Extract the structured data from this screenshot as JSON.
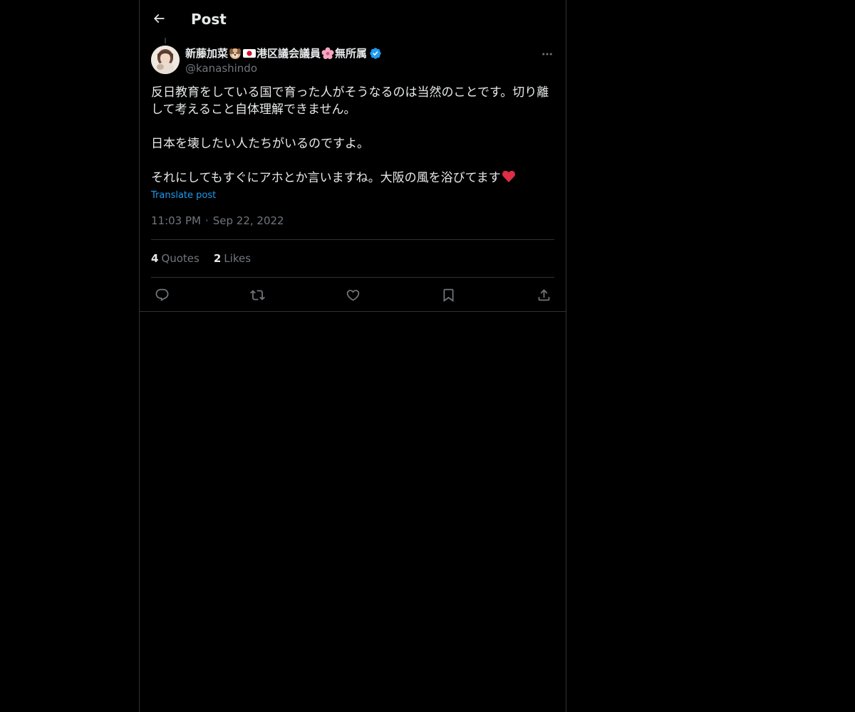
{
  "header": {
    "title": "Post",
    "back_icon": "arrow-left-icon"
  },
  "author": {
    "display_name_parts": [
      "新藤加菜",
      "港区議会議員",
      "無所属"
    ],
    "emojis": [
      "dog-face-emoji",
      "japan-flag-emoji",
      "cherry-blossom-emoji"
    ],
    "verified_icon": "verified-badge-icon",
    "handle": "@kanashindo"
  },
  "post": {
    "paragraphs": [
      "反日教育をしている国で育った人がそうなるのは当然のことです。切り離して考えること自体理解できません。",
      "日本を壊したい人たちがいるのですよ。",
      "それにしてもすぐにアホとか言いますね。大阪の風を浴びてます"
    ],
    "trailing_emoji": "red-heart-emoji",
    "translate_label": "Translate post",
    "time": "11:03 PM",
    "separator": "·",
    "date": "Sep 22, 2022"
  },
  "stats": {
    "quotes_count": "4",
    "quotes_label": "Quotes",
    "likes_count": "2",
    "likes_label": "Likes"
  },
  "actions": [
    "reply-icon",
    "repost-icon",
    "like-icon",
    "bookmark-icon",
    "share-icon"
  ],
  "colors": {
    "background": "#000000",
    "text": "#e7e9ea",
    "secondary": "#71767b",
    "accent": "#1d9bf0",
    "border": "#2f3336",
    "heart": "#f91880"
  }
}
